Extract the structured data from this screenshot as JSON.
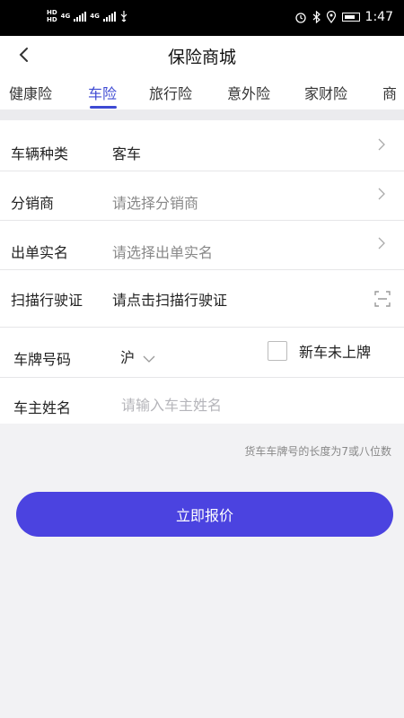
{
  "statusbar": {
    "badge1": "HD",
    "badge2": "HD",
    "net1": "4G",
    "net2": "4G",
    "time": "1:47",
    "icons": [
      "alarm-icon",
      "bluetooth-icon",
      "location-icon",
      "battery-icon"
    ]
  },
  "header": {
    "title": "保险商城"
  },
  "tabs": [
    {
      "label": "健康险"
    },
    {
      "label": "车险"
    },
    {
      "label": "旅行险"
    },
    {
      "label": "意外险"
    },
    {
      "label": "家财险"
    },
    {
      "label": "商"
    }
  ],
  "active_tab": "车险",
  "form": {
    "vehicle_type": {
      "label": "车辆种类",
      "value": "客车"
    },
    "distributor": {
      "label": "分销商",
      "placeholder": "请选择分销商"
    },
    "issuer_name": {
      "label": "出单实名",
      "placeholder": "请选择出单实名"
    },
    "scan_license": {
      "label": "扫描行驶证",
      "placeholder": "请点击扫描行驶证"
    },
    "plate": {
      "label": "车牌号码",
      "province": "沪",
      "new_car_label": "新车未上牌",
      "new_car_checked": false
    },
    "owner_name": {
      "label": "车主姓名",
      "placeholder": "请输入车主姓名"
    }
  },
  "note": "货车车牌号的长度为7或八位数",
  "submit_label": "立即报价",
  "colors": {
    "accent": "#4b43e0",
    "tab_active": "#3e4ad3"
  }
}
